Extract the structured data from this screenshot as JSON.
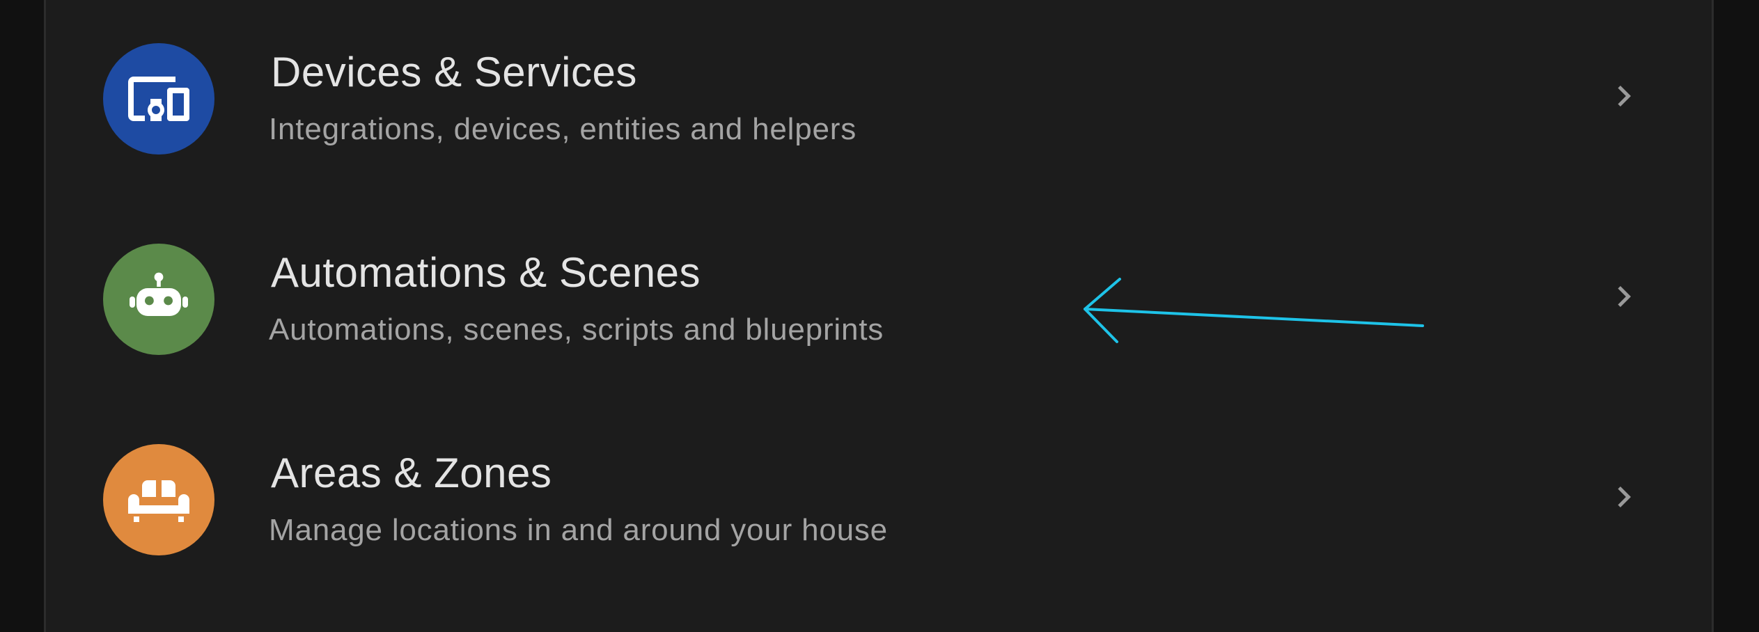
{
  "settings_list": {
    "items": [
      {
        "title": "Devices & Services",
        "subtitle": "Integrations, devices, entities and helpers",
        "icon": "devices-icon",
        "icon_bg": "#1e4ba3"
      },
      {
        "title": "Automations & Scenes",
        "subtitle": "Automations, scenes, scripts and blueprints",
        "icon": "robot-icon",
        "icon_bg": "#5b8a4a"
      },
      {
        "title": "Areas & Zones",
        "subtitle": "Manage locations in and around your house",
        "icon": "sofa-icon",
        "icon_bg": "#e08a3e"
      }
    ]
  },
  "annotation": {
    "icon": "arrow-left-annotation",
    "color": "#1ec3e8"
  },
  "colors": {
    "background": "#111111",
    "card": "#1c1c1c",
    "title_text": "#e4e4e4",
    "subtitle_text": "#a4a4a4",
    "chevron": "#9a9a9a"
  }
}
